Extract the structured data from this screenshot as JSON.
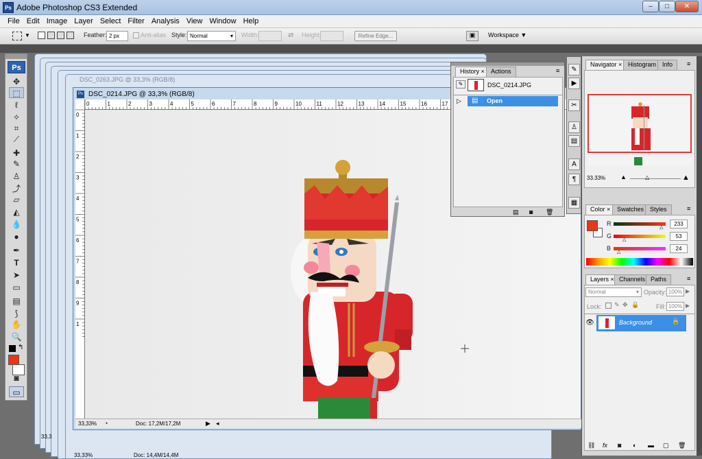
{
  "window": {
    "title": "Adobe Photoshop CS3 Extended",
    "minimize": "–",
    "maximize": "□",
    "close": "✕",
    "app_logo": "Ps"
  },
  "menu": [
    "File",
    "Edit",
    "Image",
    "Layer",
    "Select",
    "Filter",
    "Analysis",
    "View",
    "Window",
    "Help"
  ],
  "options": {
    "feather_label": "Feather:",
    "feather_value": "2 px",
    "antialias_label": "Anti-alias",
    "style_label": "Style:",
    "style_value": "Normal",
    "width_label": "Width:",
    "height_label": "Height:",
    "refine_edge": "Refine Edge...",
    "workspace": "Workspace ▼"
  },
  "toolbox": {
    "logo": "Ps"
  },
  "documents": {
    "main_title": "DSC_0214.JPG @ 33,3% (RGB/8)",
    "back_title": "DSC_0263.JPG @ 33,3% (RGB/8)",
    "zoom": "33,33%",
    "doc_info": "Doc: 17,2M/17,2M",
    "back_zoom": "33,33%",
    "back_doc_info": "Doc: 14,4M/14,4M",
    "back_zoom2": "33,3"
  },
  "rulers": {
    "h": [
      "0",
      "1",
      "2",
      "3",
      "4",
      "5",
      "6",
      "7",
      "8",
      "9",
      "10",
      "11",
      "12",
      "13",
      "14",
      "15",
      "16",
      "17"
    ],
    "v": [
      "0",
      "1",
      "2",
      "3",
      "4",
      "5",
      "6",
      "7",
      "8",
      "9",
      "1"
    ]
  },
  "history": {
    "tabs": [
      "History",
      "Actions"
    ],
    "snapshot": "DSC_0214.JPG",
    "steps": [
      "Open"
    ]
  },
  "navigator": {
    "tabs": [
      "Navigator",
      "Histogram",
      "Info"
    ],
    "zoom": "33.33%"
  },
  "color": {
    "tabs": [
      "Color",
      "Swatches",
      "Styles"
    ],
    "channels": [
      {
        "label": "R",
        "value": "233"
      },
      {
        "label": "G",
        "value": "53"
      },
      {
        "label": "B",
        "value": "24"
      }
    ],
    "foreground": "#e93518"
  },
  "layers": {
    "tabs": [
      "Layers",
      "Channels",
      "Paths"
    ],
    "blend": "Normal",
    "opacity_label": "Opacity:",
    "opacity": "100%",
    "lock_label": "Lock:",
    "fill_label": "Fill:",
    "fill": "100%",
    "items": [
      {
        "name": "Background"
      }
    ]
  }
}
